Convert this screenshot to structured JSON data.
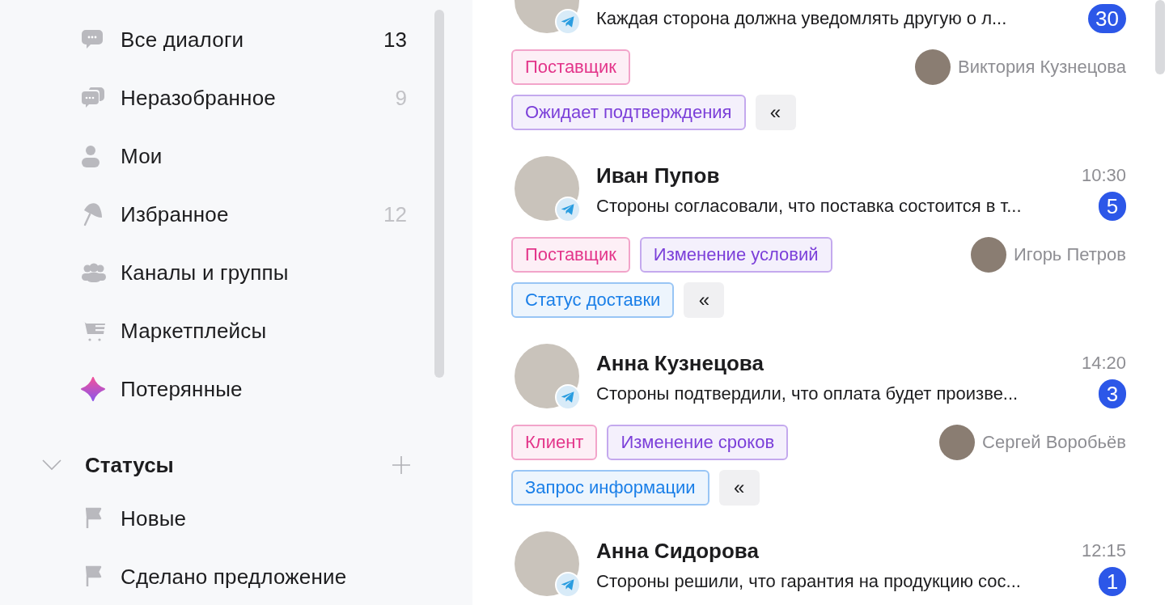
{
  "sidebar": {
    "items": [
      {
        "label": "Все диалоги",
        "count": "13",
        "unread": true
      },
      {
        "label": "Неразобранное",
        "count": "9",
        "unread": false
      },
      {
        "label": "Мои"
      },
      {
        "label": "Избранное",
        "count": "12",
        "unread": false
      },
      {
        "label": "Каналы и группы"
      },
      {
        "label": "Маркетплейсы"
      },
      {
        "label": "Потерянные"
      }
    ],
    "sections": [
      {
        "title": "Статусы",
        "expanded": true,
        "items": [
          {
            "label": "Новые"
          },
          {
            "label": "Сделано предложение"
          }
        ]
      }
    ]
  },
  "dialogs": [
    {
      "preview": "Каждая сторона должна уведомлять другую о л...",
      "unread": "30",
      "owner": "Виктория Кузнецова",
      "collapse_label": "«",
      "tag_rows": [
        [
          {
            "label": "Поставщик",
            "color": "#e3358a"
          }
        ],
        [
          {
            "label": "Ожидает подтверждения",
            "color": "#7b3fd9"
          }
        ]
      ]
    },
    {
      "name": "Иван Пупов",
      "time": "10:30",
      "preview": "Стороны согласовали, что поставка состоится в т...",
      "unread": "5",
      "owner": "Игорь Петров",
      "collapse_label": "«",
      "tag_rows": [
        [
          {
            "label": "Поставщик",
            "color": "#e3358a"
          },
          {
            "label": "Изменение условий",
            "color": "#7b3fd9"
          }
        ],
        [
          {
            "label": "Статус доставки",
            "color": "#1a7fe8"
          }
        ]
      ]
    },
    {
      "name": "Анна Кузнецова",
      "time": "14:20",
      "preview": "Стороны подтвердили, что оплата будет произве...",
      "unread": "3",
      "owner": "Сергей Воробьёв",
      "collapse_label": "«",
      "tag_rows": [
        [
          {
            "label": "Клиент",
            "color": "#e3358a"
          },
          {
            "label": "Изменение сроков",
            "color": "#7b3fd9"
          }
        ],
        [
          {
            "label": "Запрос информации",
            "color": "#1a7fe8"
          }
        ]
      ]
    },
    {
      "name": "Анна Сидорова",
      "time": "12:15",
      "preview": "Стороны решили, что гарантия на продукцию сос...",
      "unread": "1"
    }
  ]
}
